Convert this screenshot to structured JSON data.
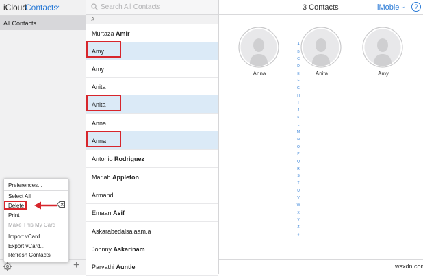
{
  "header": {
    "icloud": "iCloud",
    "app": "Contacts",
    "chevron": "⌄"
  },
  "groups": [
    {
      "label": "All Contacts"
    }
  ],
  "menu": {
    "items": [
      "Preferences...",
      "Select All",
      "Delete",
      "Print",
      "Make This My Card",
      "Import vCard...",
      "Export vCard...",
      "Refresh Contacts"
    ],
    "highlighted": "Delete",
    "disabled": [
      "Make This My Card"
    ]
  },
  "search": {
    "placeholder": "Search All Contacts"
  },
  "list": {
    "section": "A",
    "contacts": [
      {
        "first": "Murtaza",
        "last": "Amir",
        "selected": false
      },
      {
        "first": "",
        "last": "Amy",
        "selected": true
      },
      {
        "first": "",
        "last": "Amy",
        "selected": false
      },
      {
        "first": "",
        "last": "Anita",
        "selected": false
      },
      {
        "first": "",
        "last": "Anita",
        "selected": true
      },
      {
        "first": "",
        "last": "Anna",
        "selected": false
      },
      {
        "first": "",
        "last": "Anna",
        "selected": true
      },
      {
        "first": "Antonio",
        "last": "Rodriguez",
        "selected": false
      },
      {
        "first": "Mariah",
        "last": "Appleton",
        "selected": false
      },
      {
        "first": "",
        "last": "Armand",
        "selected": false
      },
      {
        "first": "Emaan",
        "last": "Asif",
        "selected": false
      },
      {
        "first": "",
        "last": "Askarabedalsalaam.a",
        "selected": false
      },
      {
        "first": "Johnny",
        "last": "Askarinam",
        "selected": false
      },
      {
        "first": "Parvathi",
        "last": "Auntie",
        "selected": false
      }
    ]
  },
  "alphabet": [
    "A",
    "B",
    "C",
    "D",
    "E",
    "F",
    "G",
    "H",
    "I",
    "J",
    "K",
    "L",
    "M",
    "N",
    "O",
    "P",
    "Q",
    "R",
    "S",
    "T",
    "U",
    "V",
    "W",
    "X",
    "Y",
    "Z",
    "#"
  ],
  "detail": {
    "count_label": "3 Contacts",
    "account": "iMobie",
    "help": "?",
    "cards": [
      "Anna",
      "Anita",
      "Amy"
    ]
  },
  "watermark": "wsxdn.com",
  "colors": {
    "accent": "#2b7bd6",
    "highlight": "#d7262c",
    "selection": "#dbeaf7"
  }
}
